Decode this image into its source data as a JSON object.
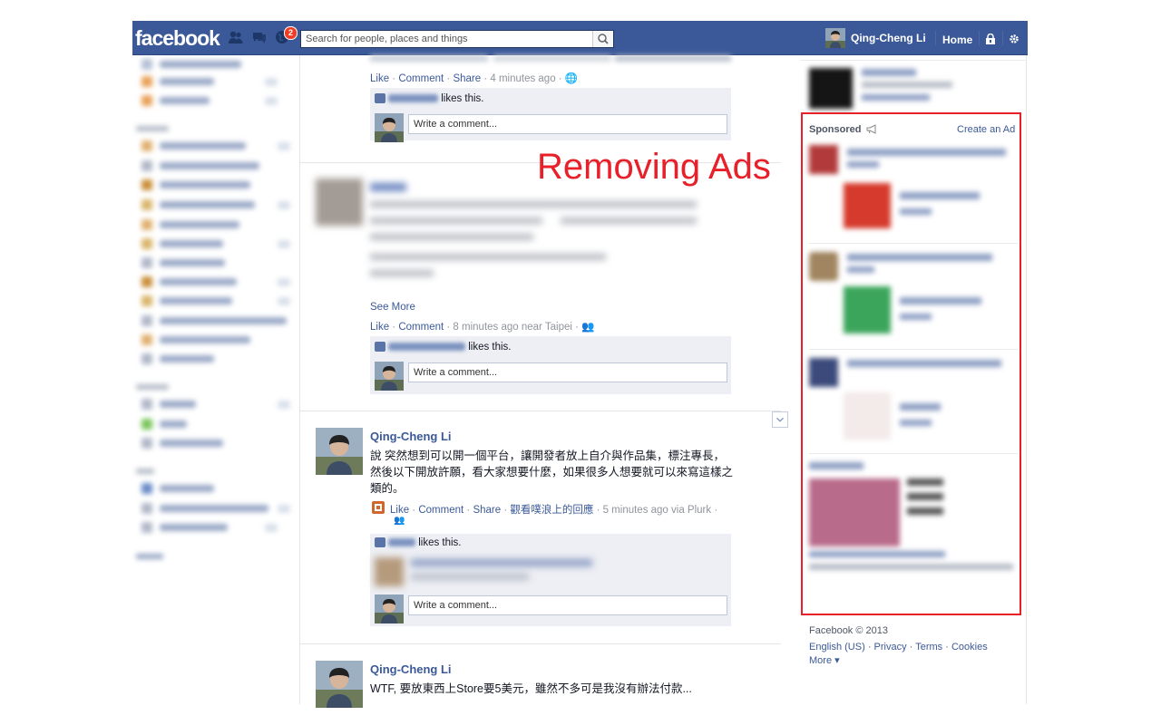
{
  "topbar": {
    "logo": "facebook",
    "notification_count": "2",
    "search_placeholder": "Search for people, places and things",
    "user_name": "Qing-Cheng Li",
    "home_label": "Home"
  },
  "feed": {
    "post1": {
      "actions": {
        "like": "Like",
        "comment": "Comment",
        "share": "Share",
        "meta": "· 4 minutes ago ·"
      },
      "likes_suffix": "likes this.",
      "comment_placeholder": "Write a comment..."
    },
    "post2": {
      "see_more": "See More",
      "actions": {
        "like": "Like",
        "comment": "Comment",
        "meta": "· 8 minutes ago near Taipei ·"
      },
      "likes_suffix": "likes this.",
      "comment_placeholder": "Write a comment..."
    },
    "post3": {
      "author": "Qing-Cheng Li",
      "text_line1": "說 突然想到可以開一個平台，讓開發者放上自介與作品集，標注專長，",
      "text_line2": "然後以下開放許願，看大家想要什麼，如果很多人想要就可以來寫這樣之",
      "text_line3": "類的。",
      "actions": {
        "like": "Like",
        "comment": "Comment",
        "share": "Share",
        "plurk": "觀看噗浪上的回應",
        "meta": "· 5 minutes ago via Plurk ·"
      },
      "likes_suffix": "likes this.",
      "comment_placeholder": "Write a comment..."
    },
    "post4": {
      "author": "Qing-Cheng Li",
      "text_line1": "WTF, 要放東西上Store要5美元，雖然不多可是我沒有辦法付款..."
    }
  },
  "sidebar": {
    "sponsored_title": "Sponsored",
    "create_ad": "Create an Ad"
  },
  "overlay": {
    "title": "Removing Ads"
  },
  "footer": {
    "copyright": "Facebook © 2013",
    "links": [
      "English (US)",
      "Privacy",
      "Terms",
      "Cookies"
    ],
    "more": "More ▾"
  },
  "colors": {
    "brand_blue": "#3b5998",
    "highlight_red": "#e8202a"
  }
}
